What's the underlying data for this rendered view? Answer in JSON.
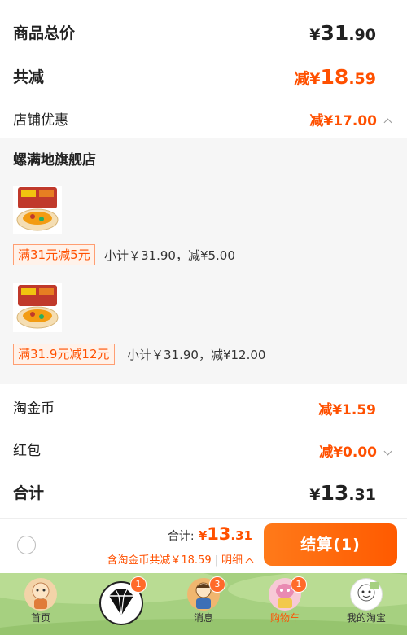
{
  "summary": {
    "total_label": "商品总价",
    "total_currency": "¥",
    "total_int": "31",
    "total_dec": ".90",
    "discount_label": "共减",
    "discount_prefix": "减¥",
    "discount_int": "18",
    "discount_dec": ".59",
    "shop_discount_label": "店铺优惠",
    "shop_discount_value": "减¥17.00"
  },
  "store": {
    "name": "螺满地旗舰店",
    "items": [
      {
        "coupon": "满31元减5元",
        "subtotal": "小计￥31.90，减¥5.00"
      },
      {
        "coupon": "满31.9元减12元",
        "subtotal": "小计￥31.90，减¥12.00"
      }
    ]
  },
  "taojinbi": {
    "label": "淘金币",
    "value": "减¥1.59"
  },
  "hongbao": {
    "label": "红包",
    "value": "减¥0.00"
  },
  "grand_total": {
    "label": "合计",
    "currency": "¥",
    "int": "13",
    "dec": ".31"
  },
  "checkout": {
    "total_label": "合计:",
    "total_currency": "¥",
    "total_int": "13",
    "total_dec": ".31",
    "note": "含淘金币共减￥18.59",
    "detail_label": "明细",
    "pay_button": "结算(1)"
  },
  "tabbar": {
    "tabs": [
      {
        "label": "首页",
        "icon": "home-icon"
      },
      {
        "label": "",
        "icon": "diamond-icon",
        "badge": "1"
      },
      {
        "label": "消息",
        "icon": "messages-icon",
        "badge": "3"
      },
      {
        "label": "购物车",
        "icon": "cart-icon",
        "badge": "1",
        "active": true
      },
      {
        "label": "我的淘宝",
        "icon": "profile-icon"
      }
    ]
  },
  "colors": {
    "accent": "#ff5000",
    "tabbar_bg": "#a6d080"
  }
}
